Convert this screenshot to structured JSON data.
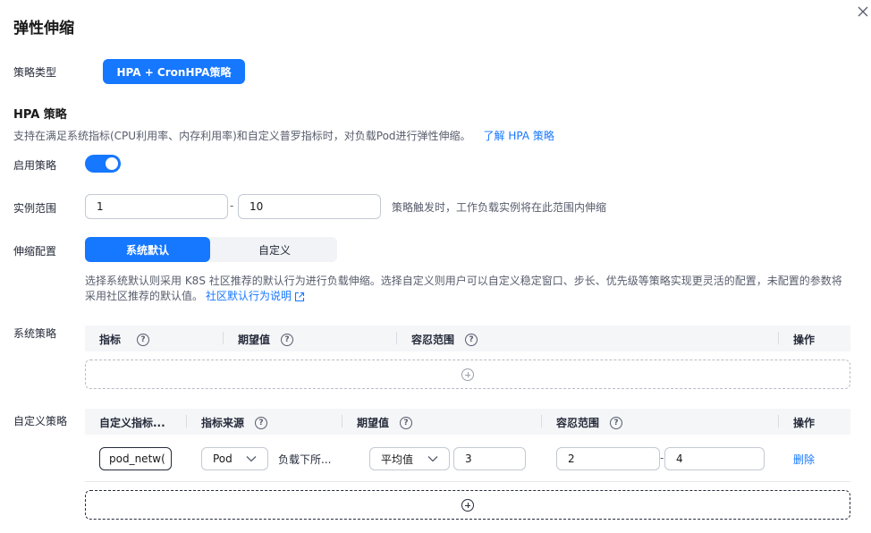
{
  "dialog": {
    "title": "弹性伸缩"
  },
  "strategy_type": {
    "label": "策略类型",
    "value": "HPA + CronHPA策略"
  },
  "hpa": {
    "section_title": "HPA 策略",
    "description": "支持在满足系统指标(CPU利用率、内存利用率)和自定义普罗指标时，对负载Pod进行弹性伸缩。",
    "learn_link": "了解 HPA 策略",
    "enable_label": "启用策略",
    "enabled": true,
    "instance_range": {
      "label": "实例范围",
      "min": "1",
      "separator": "-",
      "max": "10",
      "hint": "策略触发时，工作负载实例将在此范围内伸缩"
    },
    "scaling_config": {
      "label": "伸缩配置",
      "options": [
        "系统默认",
        "自定义"
      ],
      "selected": "系统默认",
      "desc_line1": "选择系统默认则采用 K8S 社区推荐的默认行为进行负载伸缩。选择自定义则用户可以自定义稳定窗口、步长、优先级等策略实现更灵活的配置，未配置的参数将",
      "desc_line2": "采用社区推荐的默认值。",
      "desc_link": "社区默认行为说明"
    },
    "system_policy": {
      "label": "系统策略",
      "columns": [
        "指标",
        "期望值",
        "容忍范围",
        "操作"
      ]
    },
    "custom_policy": {
      "label": "自定义策略",
      "columns": [
        "自定义指标...",
        "指标来源",
        "期望值",
        "容忍范围",
        "操作"
      ],
      "rows": [
        {
          "metric_name": "pod_netw(",
          "source": "Pod",
          "source_desc": "负载下所...",
          "expect_type": "平均值",
          "expect_value": "3",
          "tolerance_min": "2",
          "tolerance_sep": "-",
          "tolerance_max": "4",
          "action": "删除"
        }
      ]
    }
  },
  "icons": {
    "close": "close-icon",
    "help": "question-circle-icon",
    "add": "plus-circle-icon",
    "external": "external-link-icon",
    "chevron": "chevron-down-icon"
  },
  "colors": {
    "primary": "#1677ff",
    "text": "#252b3a"
  }
}
